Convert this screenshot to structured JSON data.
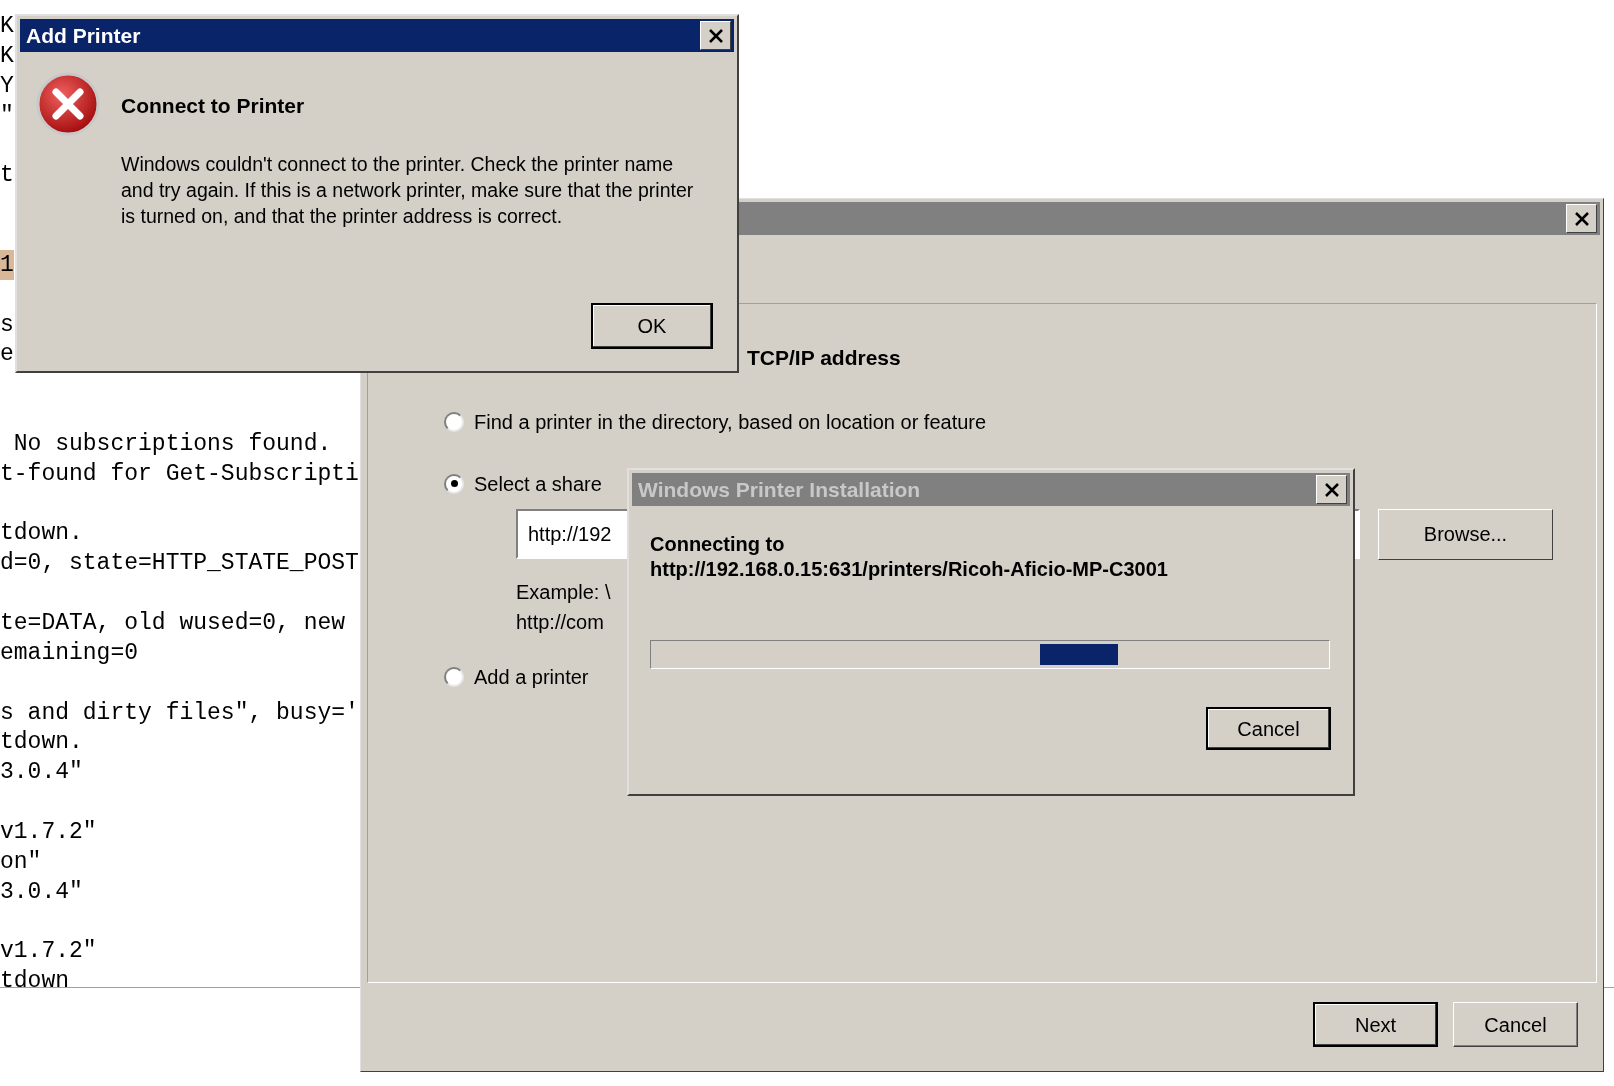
{
  "terminal": {
    "lines": [
      {
        "text": "K",
        "highlighted": false
      },
      {
        "text": "K",
        "highlighted": false
      },
      {
        "text": "Y",
        "highlighted": false
      },
      {
        "text": "\"",
        "highlighted": false
      },
      {
        "text": "t",
        "highlighted": false
      },
      {
        "text": "1",
        "highlighted": true
      },
      {
        "text": "s",
        "highlighted": false
      },
      {
        "text": "e",
        "highlighted": false
      },
      {
        "text": " No subscriptions found.",
        "highlighted": false
      },
      {
        "text": "t-found for Get-Subscripti",
        "highlighted": false
      },
      {
        "text": "tdown.",
        "highlighted": false
      },
      {
        "text": "d=0, state=HTTP_STATE_POST",
        "highlighted": false
      },
      {
        "text": "te=DATA, old wused=0, new",
        "highlighted": false
      },
      {
        "text": "emaining=0",
        "highlighted": false
      },
      {
        "text": "s and dirty files\", busy='",
        "highlighted": false
      },
      {
        "text": "tdown.",
        "highlighted": false
      },
      {
        "text": "3.0.4\"",
        "highlighted": false
      },
      {
        "text": "v1.7.2\"",
        "highlighted": false
      },
      {
        "text": "on\"",
        "highlighted": false
      },
      {
        "text": "3.0.4\"",
        "highlighted": false
      },
      {
        "text": "v1.7.2\"",
        "highlighted": false
      },
      {
        "text": "tdown",
        "highlighted": false
      }
    ]
  },
  "wizard": {
    "active": false,
    "heading": "TCP/IP address",
    "options": [
      {
        "label": "Find a printer in the directory, based on location or feature",
        "selected": false
      },
      {
        "label": "Select a share",
        "selected": true
      },
      {
        "label": "Add a printer",
        "selected": false
      }
    ],
    "url_field": {
      "value": "http://192"
    },
    "browse_button": "Browse...",
    "example_lines": [
      "Example: \\",
      "http://com"
    ],
    "buttons": [
      {
        "label": "Next",
        "default": true
      },
      {
        "label": "Cancel",
        "default": false
      }
    ]
  },
  "install_dialog": {
    "title": "Windows Printer Installation",
    "active": false,
    "message": "Connecting to",
    "target": "http://192.168.0.15:631/printers/Ricoh-Aficio-MP-C3001",
    "progress": {
      "indeterminate": true
    },
    "buttons": [
      {
        "label": "Cancel",
        "default": true
      }
    ]
  },
  "error_dialog": {
    "title": "Add Printer",
    "active": true,
    "heading": "Connect to Printer",
    "message": "Windows couldn't connect to the printer. Check the printer name and try again. If this is a network printer, make sure that the printer is turned on, and that the printer address is correct.",
    "buttons": [
      {
        "label": "OK",
        "default": true
      }
    ]
  }
}
